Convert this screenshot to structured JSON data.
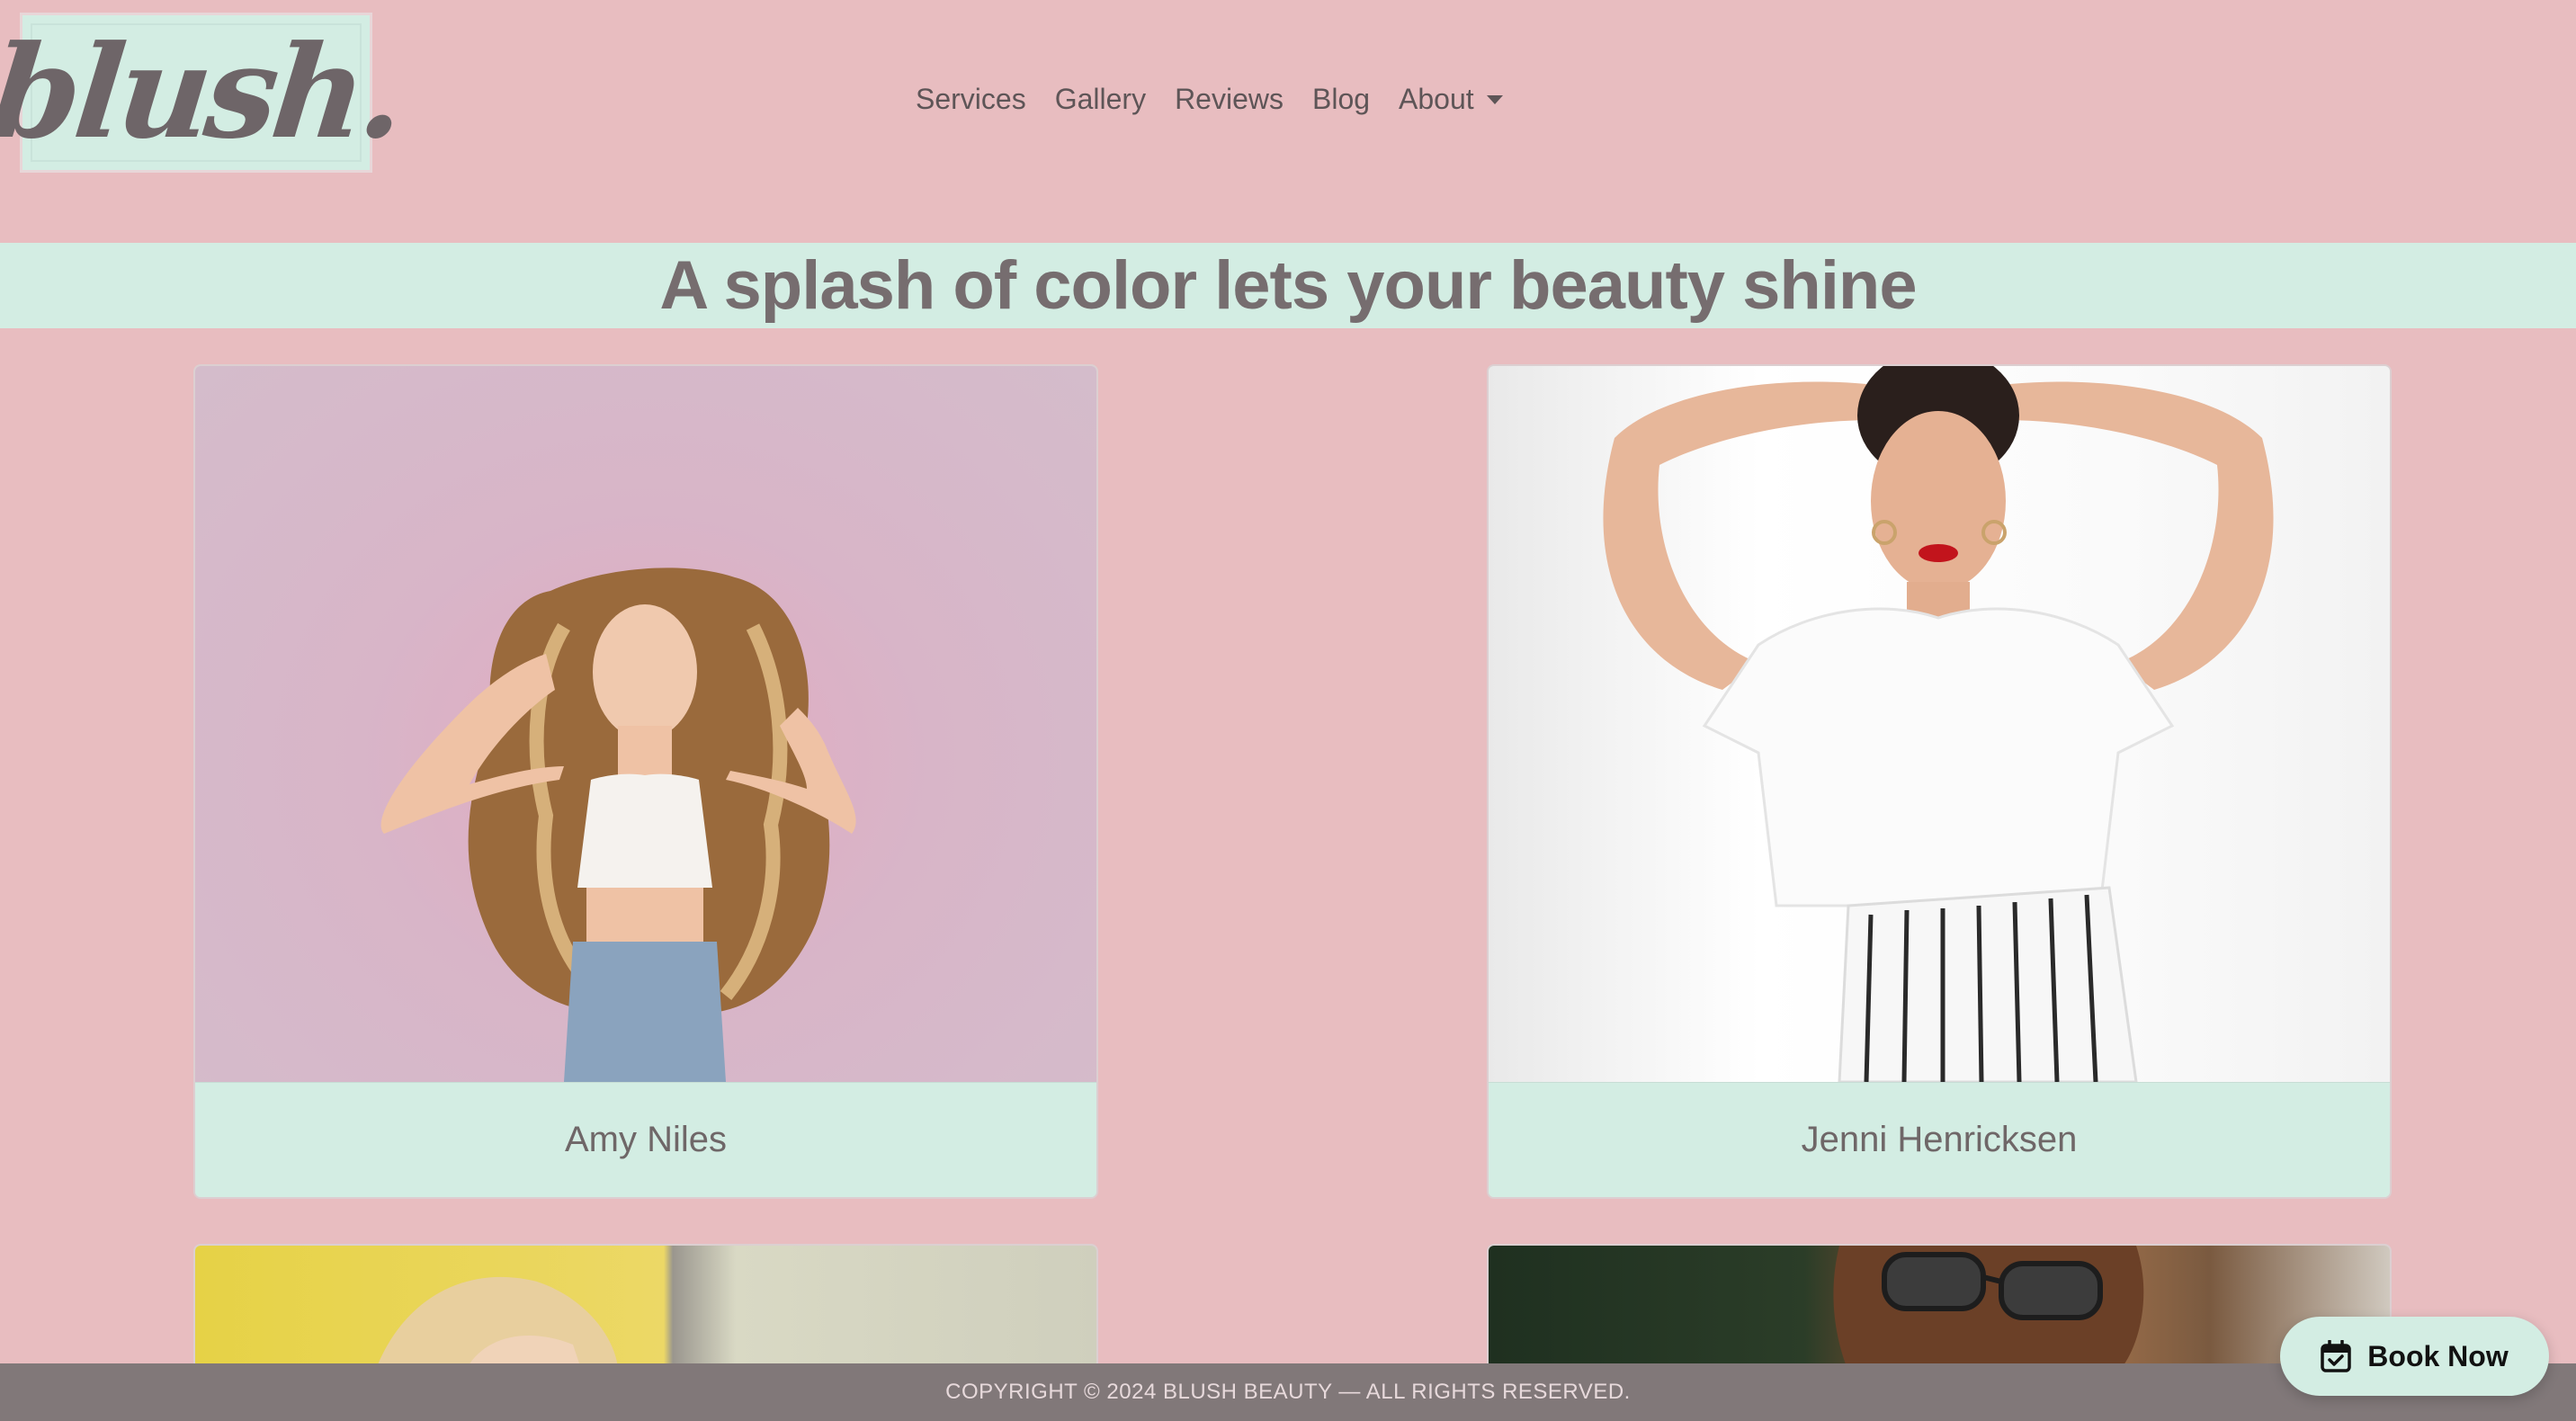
{
  "brand": {
    "logo_text": "blush."
  },
  "nav": {
    "items": [
      {
        "label": "Services"
      },
      {
        "label": "Gallery"
      },
      {
        "label": "Reviews"
      },
      {
        "label": "Blog"
      },
      {
        "label": "About",
        "has_dropdown": true
      }
    ]
  },
  "banner": {
    "title": "A splash of color lets your beauty shine"
  },
  "cards": [
    {
      "name": "Amy Niles"
    },
    {
      "name": "Jenni Henricksen"
    }
  ],
  "footer": {
    "copyright": "COPYRIGHT © 2024 BLUSH BEAUTY — ALL RIGHTS RESERVED."
  },
  "book_button": {
    "label": "Book Now",
    "icon": "calendar-check-icon"
  },
  "colors": {
    "background": "#e8bdc0",
    "mint": "#d3ede3",
    "text": "#6f6768",
    "footer": "#817879"
  }
}
